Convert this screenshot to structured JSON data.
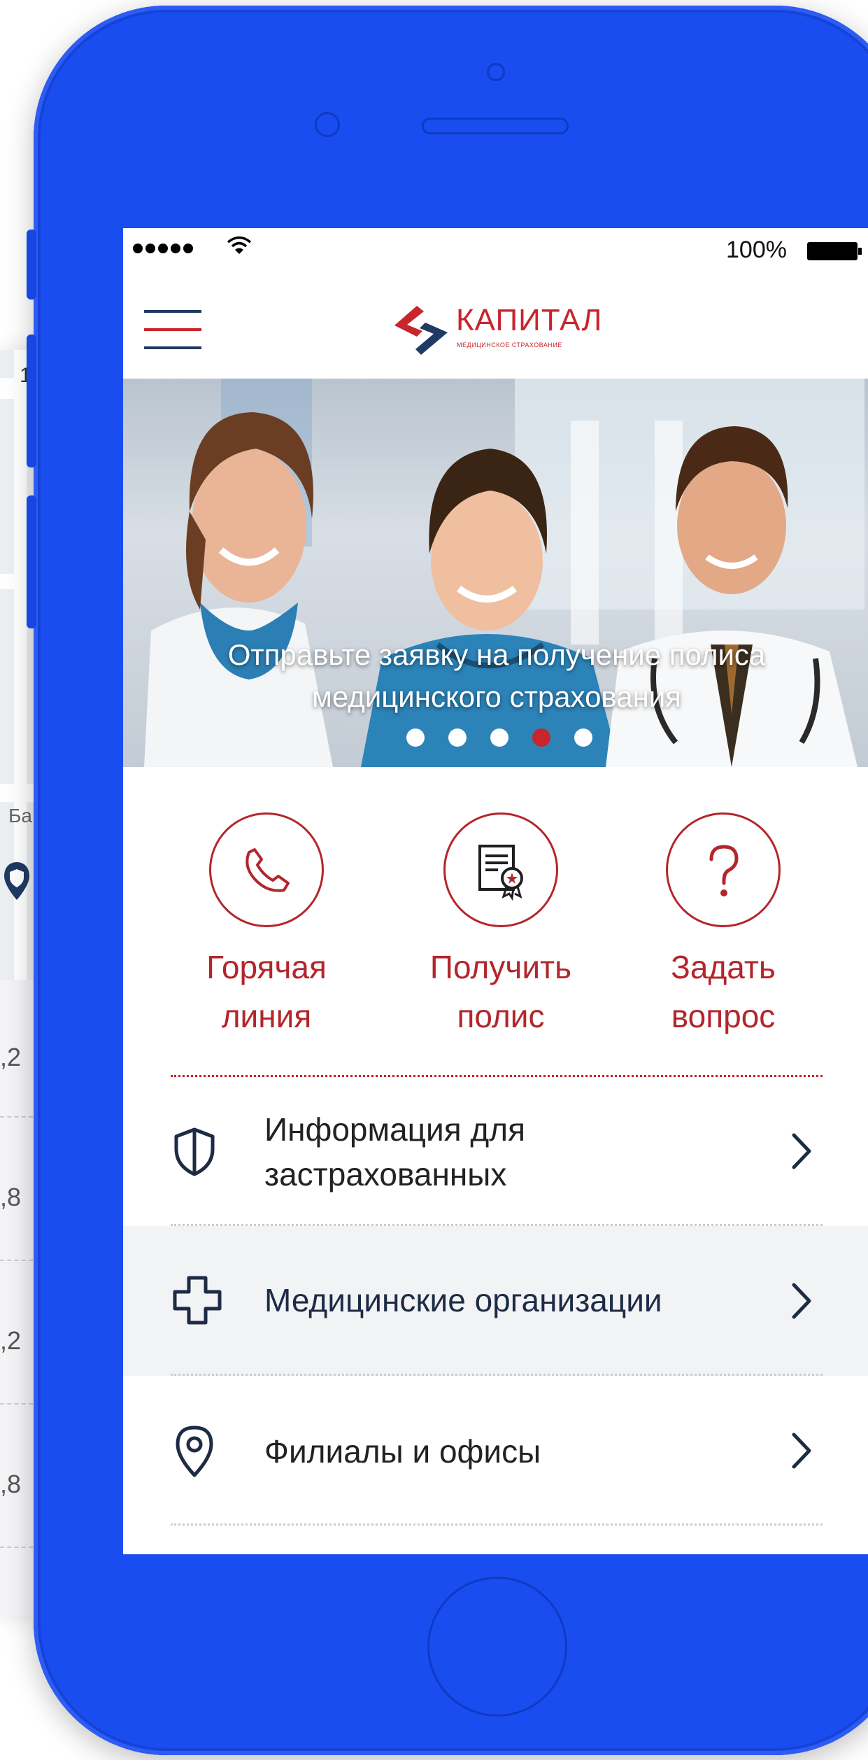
{
  "background_list": {
    "values": [
      "1",
      "Ба",
      ",2",
      ",8",
      ",2",
      ",8"
    ]
  },
  "status_bar": {
    "battery_percent": "100%"
  },
  "header": {
    "logo_name": "КАПИТАЛ",
    "logo_subtitle": "МЕДИЦИНСКОЕ СТРАХОВАНИЕ"
  },
  "banner": {
    "line1": "Отправьте заявку на получение полиса",
    "line2": "медицинского страхования",
    "pages": 5,
    "active_page": 4
  },
  "actions": [
    {
      "line1": "Горячая",
      "line2": "линия",
      "icon": "phone-icon"
    },
    {
      "line1": "Получить",
      "line2": "полис",
      "icon": "certificate-icon"
    },
    {
      "line1": "Задать",
      "line2": "вопрос",
      "icon": "question-icon"
    }
  ],
  "menu": [
    {
      "line1": "Информация для",
      "line2": "застрахованных",
      "icon": "shield-icon"
    },
    {
      "label": "Медицинские организации",
      "icon": "medical-cross-icon"
    },
    {
      "label": "Филиалы и офисы",
      "icon": "location-pin-icon"
    }
  ],
  "colors": {
    "phone": "#1a4df0",
    "accent_red": "#c8252c",
    "text_dark": "#1d2b45"
  }
}
